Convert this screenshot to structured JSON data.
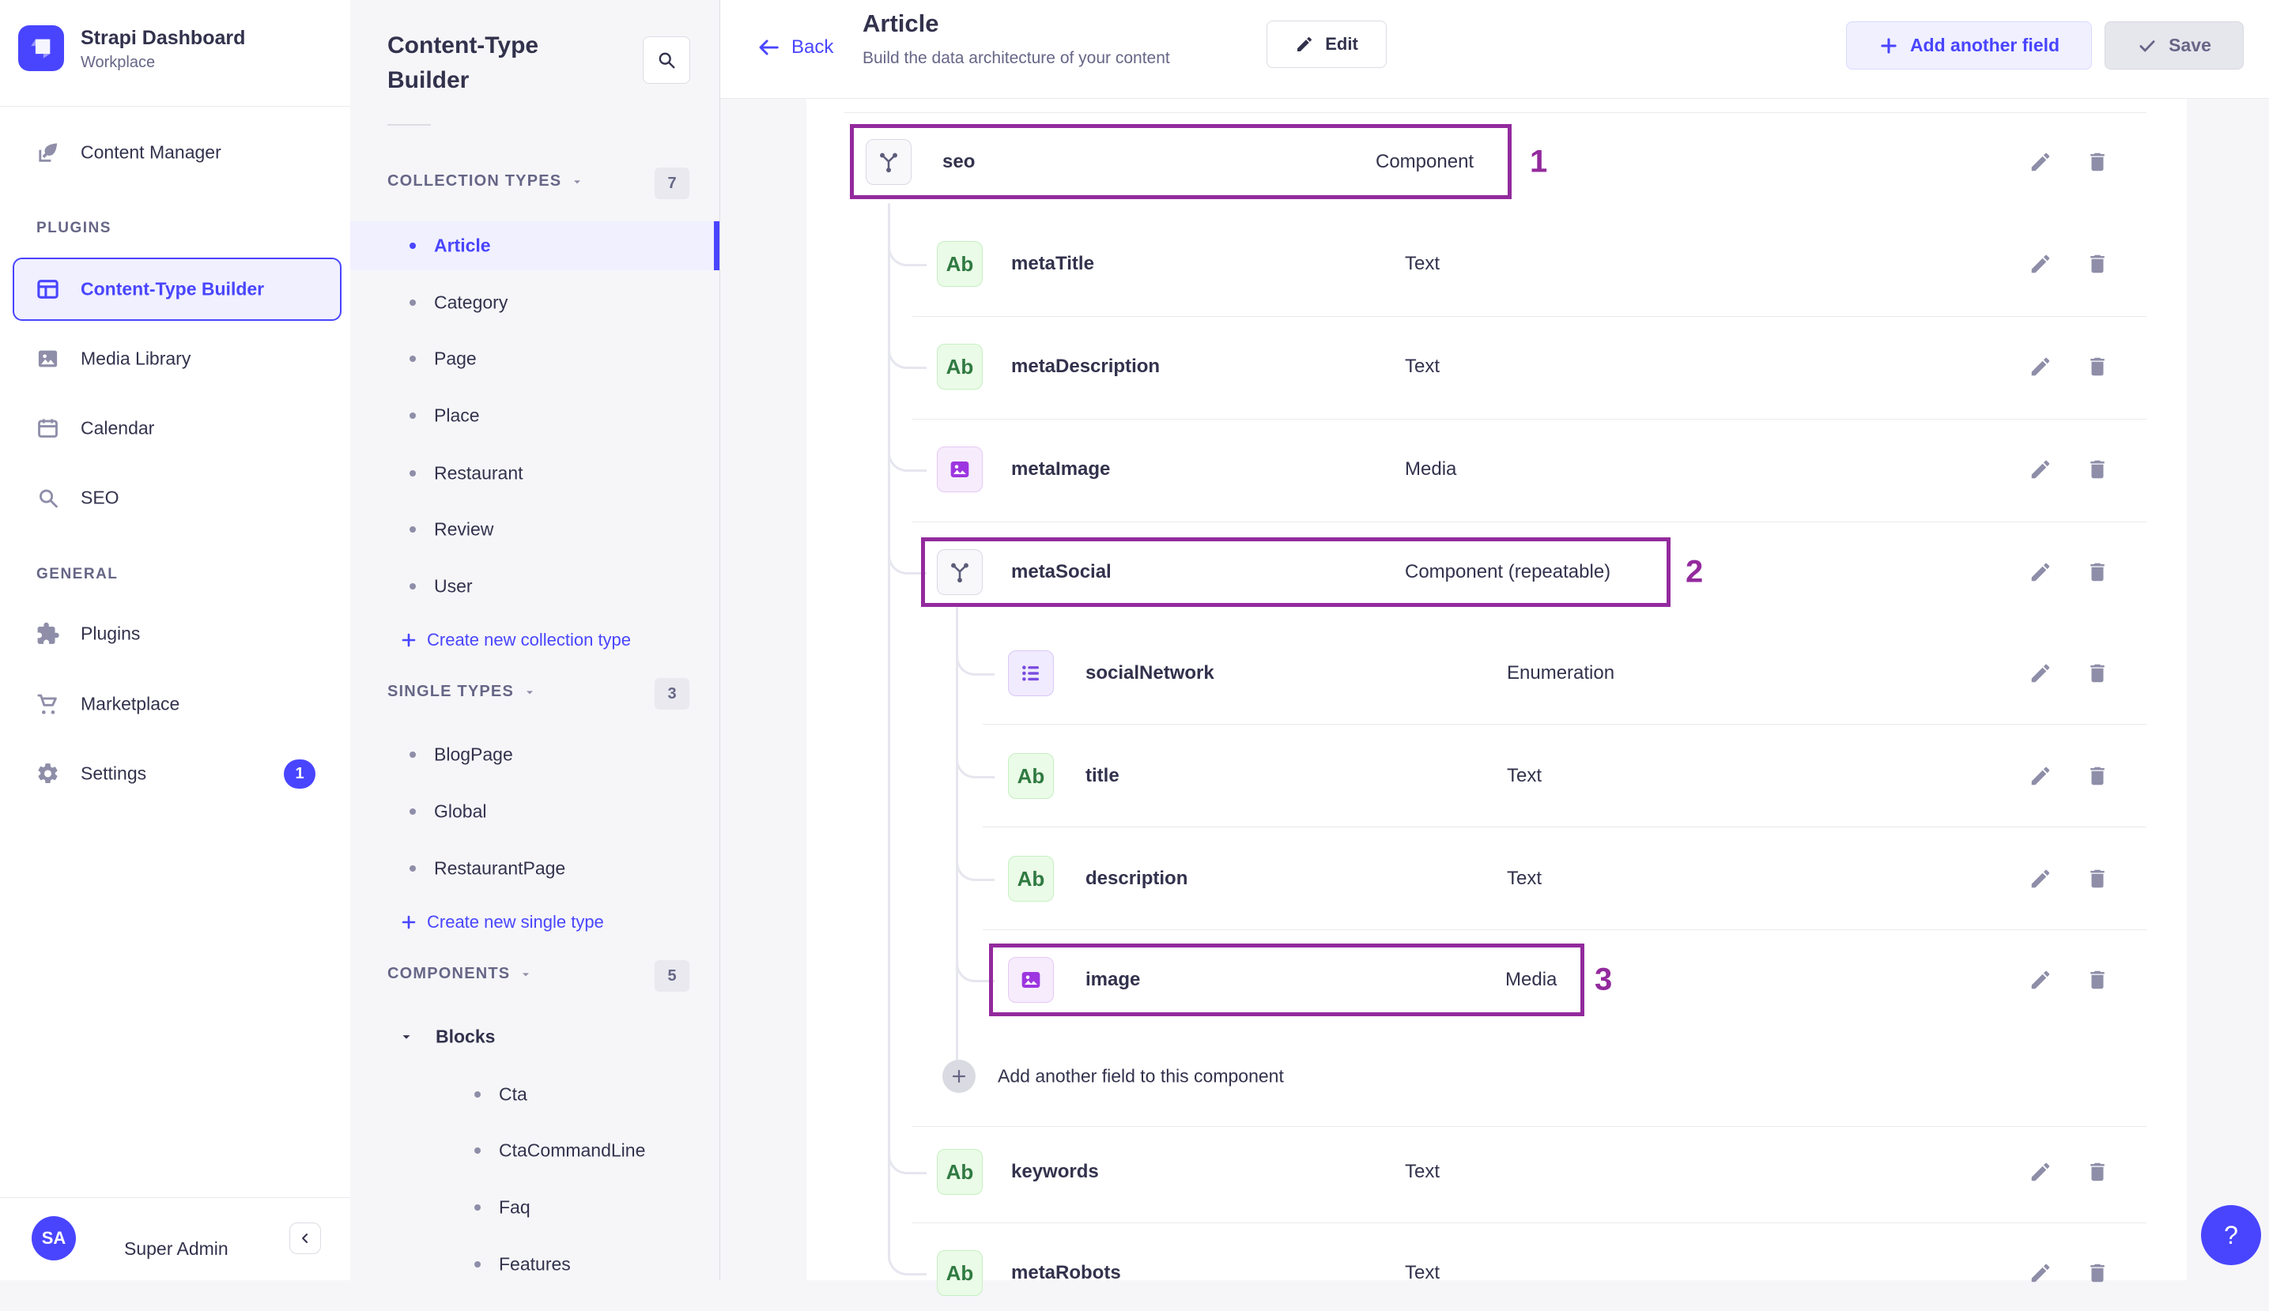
{
  "brand": {
    "title": "Strapi Dashboard",
    "subtitle": "Workplace"
  },
  "left_nav": {
    "top": [
      {
        "label": "Content Manager",
        "icon": "feather-icon"
      }
    ],
    "sections": [
      {
        "header": "PLUGINS",
        "items": [
          {
            "label": "Content-Type Builder",
            "icon": "layout-icon",
            "active": true
          },
          {
            "label": "Media Library",
            "icon": "picture-icon"
          },
          {
            "label": "Calendar",
            "icon": "calendar-icon"
          },
          {
            "label": "SEO",
            "icon": "search-icon"
          }
        ]
      },
      {
        "header": "GENERAL",
        "items": [
          {
            "label": "Plugins",
            "icon": "puzzle-icon"
          },
          {
            "label": "Marketplace",
            "icon": "cart-icon"
          },
          {
            "label": "Settings",
            "icon": "gear-icon",
            "badge": "1"
          }
        ]
      }
    ],
    "user": {
      "initials": "SA",
      "name": "Super Admin"
    }
  },
  "builder_nav": {
    "title": "Content-Type Builder",
    "sections": [
      {
        "header": "COLLECTION TYPES",
        "count": "7",
        "items": [
          {
            "label": "Article",
            "active": true
          },
          {
            "label": "Category"
          },
          {
            "label": "Page"
          },
          {
            "label": "Place"
          },
          {
            "label": "Restaurant"
          },
          {
            "label": "Review"
          },
          {
            "label": "User"
          }
        ],
        "action": "Create new collection type"
      },
      {
        "header": "SINGLE TYPES",
        "count": "3",
        "items": [
          {
            "label": "BlogPage"
          },
          {
            "label": "Global"
          },
          {
            "label": "RestaurantPage"
          }
        ],
        "action": "Create new single type"
      },
      {
        "header": "COMPONENTS",
        "count": "5",
        "groups": [
          {
            "label": "Blocks",
            "expanded": true,
            "children": [
              "Cta",
              "CtaCommandLine",
              "Faq",
              "Features"
            ]
          }
        ]
      }
    ]
  },
  "header": {
    "back": "Back",
    "title": "Article",
    "subtitle": "Build the data architecture of your content",
    "edit": "Edit",
    "add_field": "Add another field",
    "save": "Save"
  },
  "fields": {
    "rows": [
      {
        "name": "seo",
        "type": "Component",
        "icon": "component-icon",
        "annotation": "1"
      },
      {
        "name": "metaTitle",
        "type": "Text",
        "icon": "text-icon"
      },
      {
        "name": "metaDescription",
        "type": "Text",
        "icon": "text-icon"
      },
      {
        "name": "metaImage",
        "type": "Media",
        "icon": "media-icon"
      },
      {
        "name": "metaSocial",
        "type": "Component (repeatable)",
        "icon": "component-icon",
        "annotation": "2"
      },
      {
        "name": "socialNetwork",
        "type": "Enumeration",
        "icon": "enum-icon"
      },
      {
        "name": "title",
        "type": "Text",
        "icon": "text-icon"
      },
      {
        "name": "description",
        "type": "Text",
        "icon": "text-icon"
      },
      {
        "name": "image",
        "type": "Media",
        "icon": "media-icon",
        "annotation": "3"
      },
      {
        "name": "keywords",
        "type": "Text",
        "icon": "text-icon"
      },
      {
        "name": "metaRobots",
        "type": "Text",
        "icon": "text-icon"
      }
    ],
    "text_chip_label": "Ab",
    "add_component_field": "Add another field to this component"
  },
  "help": {
    "label": "?"
  },
  "colors": {
    "primary": "#4945ff",
    "annotation": "#932a9d",
    "selected_bg": "#f0f0ff"
  }
}
